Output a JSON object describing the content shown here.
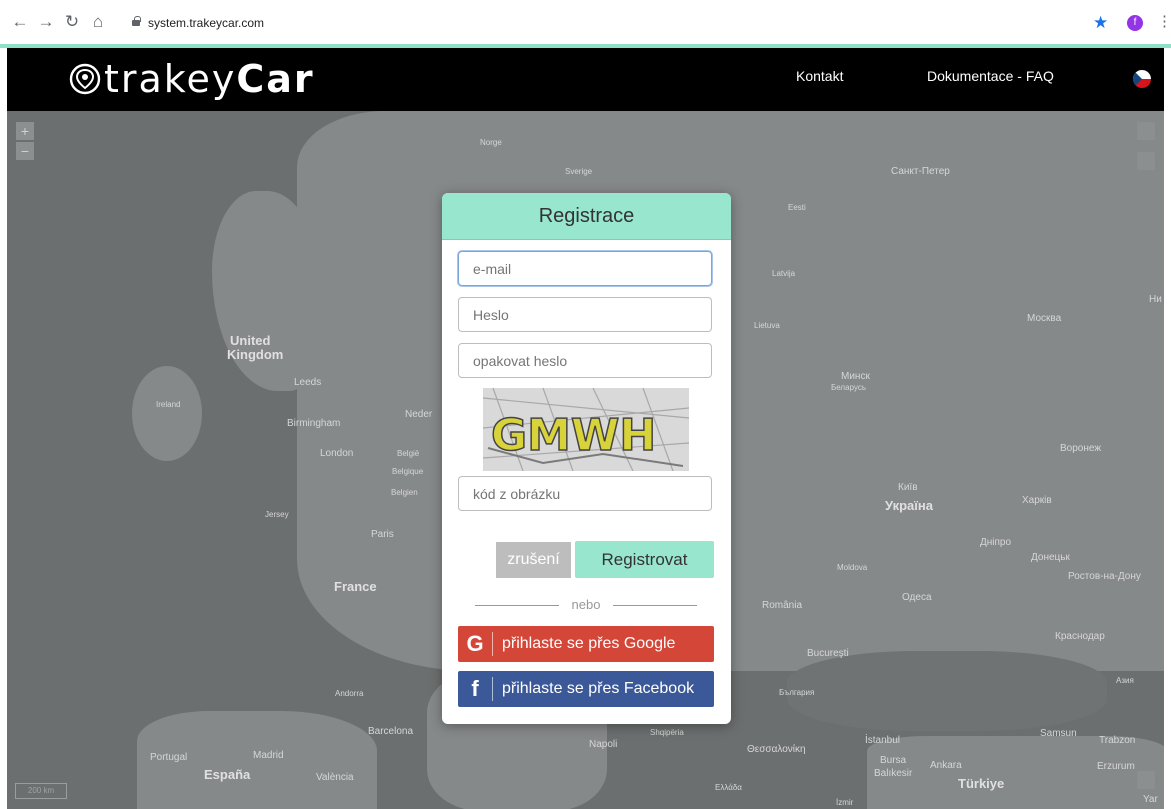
{
  "browser": {
    "url": "system.trakeycar.com",
    "profile_initial": "f",
    "icons": [
      "back-icon",
      "forward-icon",
      "reload-icon",
      "home-icon",
      "lock-icon",
      "star-icon",
      "menu-icon"
    ]
  },
  "header": {
    "logo_light": "trakey",
    "logo_bold": "Car",
    "nav": [
      "Kontakt",
      "Dokumentace - FAQ"
    ],
    "language_flag": "cz"
  },
  "map": {
    "labels": [
      "Norge",
      "Sverige",
      "Eesti",
      "Санкт-Петер",
      "Latvija",
      "Lietuva",
      "Москва",
      "Минск",
      "Беларусь",
      "United",
      "Kingdom",
      "Leeds",
      "Ireland",
      "Birmingham",
      "London",
      "Neder",
      "België",
      "Belgique",
      "Belgien",
      "Jersey",
      "Paris",
      "France",
      "Воронеж",
      "Київ",
      "Україна",
      "Харків",
      "Дніпро",
      "Донецьк",
      "Ростов-на-Дону",
      "Moldova",
      "România",
      "Одеса",
      "Bucureşti",
      "Краснодар",
      "България",
      "Andorra",
      "Barcelona",
      "Napoli",
      "Shqipëria",
      "Θεσσαλονίκη",
      "Ελλάδα",
      "İstanbul",
      "Bursa",
      "Balıkesir",
      "Ankara",
      "Türkiye",
      "Samsun",
      "Trabzon",
      "Erzurum",
      "Portugal",
      "Madrid",
      "España",
      "València",
      "Ни",
      "Yar",
      "İzmir",
      "Азия"
    ],
    "scale": "200 km"
  },
  "modal": {
    "title": "Registrace",
    "email_placeholder": "e-mail",
    "password_placeholder": "Heslo",
    "repeat_placeholder": "opakovat heslo",
    "captcha_text": "GMWH",
    "code_placeholder": "kód z obrázku",
    "cancel_label": "zrušení",
    "register_label": "Registrovat",
    "separator": "nebo",
    "google_label": "přihlaste se přes Google",
    "facebook_label": "přihlaste se přes Facebook"
  }
}
